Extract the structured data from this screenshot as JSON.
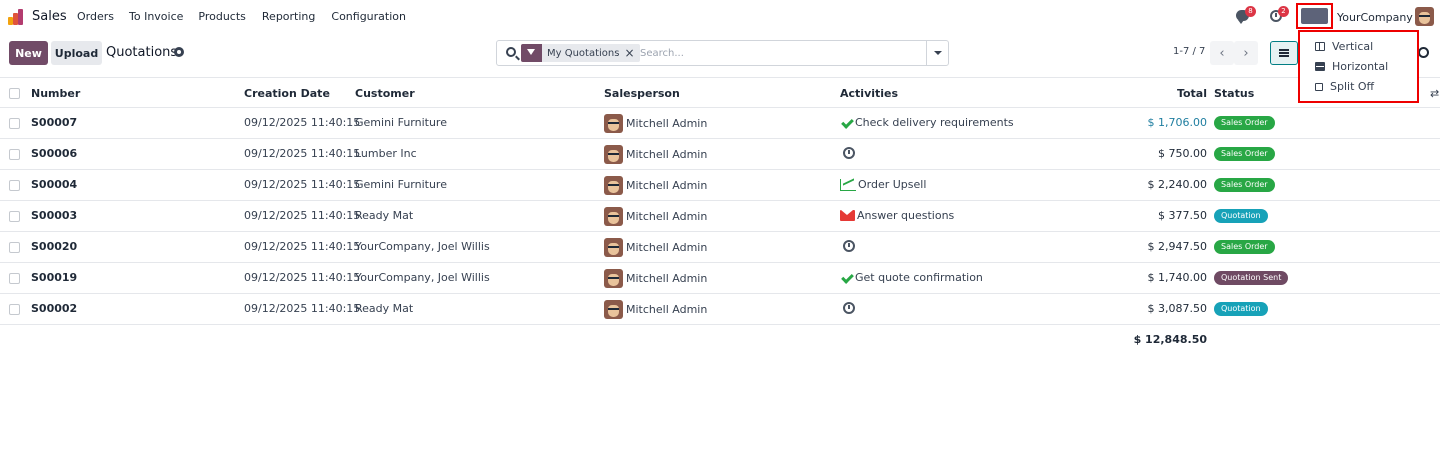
{
  "navbar": {
    "app_name": "Sales",
    "menu": [
      "Orders",
      "To Invoice",
      "Products",
      "Reporting",
      "Configuration"
    ],
    "messages_badge": "8",
    "activities_badge": "2",
    "company": "YourCompany"
  },
  "control_panel": {
    "new_label": "New",
    "upload_label": "Upload",
    "title": "Quotations",
    "facet_label": "My Quotations",
    "facet_remove": "×",
    "search_placeholder": "Search...",
    "pager": "1-7 / 7",
    "prev": "‹",
    "next": "›"
  },
  "layout_menu": {
    "items": [
      "Vertical",
      "Horizontal",
      "Split Off"
    ]
  },
  "table": {
    "headers": {
      "number": "Number",
      "creation_date": "Creation Date",
      "customer": "Customer",
      "salesperson": "Salesperson",
      "activities": "Activities",
      "total": "Total",
      "status": "Status"
    },
    "rows": [
      {
        "number": "S00007",
        "date": "09/12/2025 11:40:15",
        "customer": "Gemini Furniture",
        "salesperson": "Mitchell Admin",
        "activity_icon": "check-icon",
        "activity": "Check delivery requirements",
        "total": "$ 1,706.00",
        "status": "Sales Order"
      },
      {
        "number": "S00006",
        "date": "09/12/2025 11:40:15",
        "customer": "Lumber Inc",
        "salesperson": "Mitchell Admin",
        "activity_icon": "clock-icon",
        "activity": "",
        "total": "$ 750.00",
        "status": "Sales Order"
      },
      {
        "number": "S00004",
        "date": "09/12/2025 11:40:15",
        "customer": "Gemini Furniture",
        "salesperson": "Mitchell Admin",
        "activity_icon": "chart-line-icon",
        "activity": "Order Upsell",
        "total": "$ 2,240.00",
        "status": "Sales Order"
      },
      {
        "number": "S00003",
        "date": "09/12/2025 11:40:15",
        "customer": "Ready Mat",
        "salesperson": "Mitchell Admin",
        "activity_icon": "envelope-icon",
        "activity": "Answer questions",
        "total": "$ 377.50",
        "status": "Quotation"
      },
      {
        "number": "S00020",
        "date": "09/12/2025 11:40:15",
        "customer": "YourCompany, Joel Willis",
        "salesperson": "Mitchell Admin",
        "activity_icon": "clock-icon",
        "activity": "",
        "total": "$ 2,947.50",
        "status": "Sales Order"
      },
      {
        "number": "S00019",
        "date": "09/12/2025 11:40:15",
        "customer": "YourCompany, Joel Willis",
        "salesperson": "Mitchell Admin",
        "activity_icon": "check-icon",
        "activity": "Get quote confirmation",
        "total": "$ 1,740.00",
        "status": "Quotation Sent"
      },
      {
        "number": "S00002",
        "date": "09/12/2025 11:40:15",
        "customer": "Ready Mat",
        "salesperson": "Mitchell Admin",
        "activity_icon": "clock-icon",
        "activity": "",
        "total": "$ 3,087.50",
        "status": "Quotation"
      }
    ],
    "sum_total": "$ 12,848.50"
  },
  "colors": {
    "brand": "#714b67",
    "sales_order": "#28a745",
    "quotation": "#17a2b8",
    "quotation_sent": "#6f4a63",
    "highlight_total": "#1f7ea0",
    "annotation_box": "#ee0000"
  }
}
